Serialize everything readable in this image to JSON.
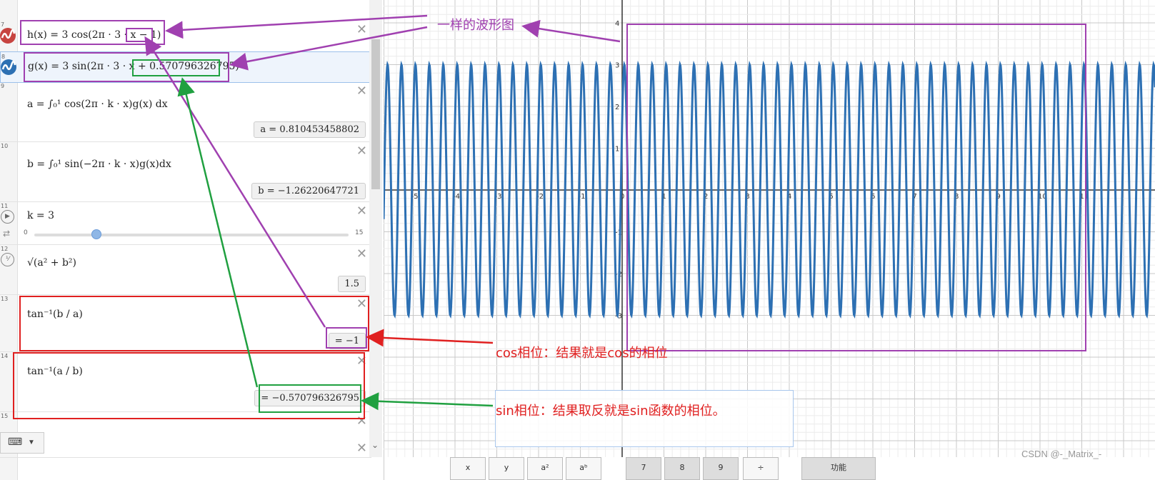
{
  "rows": [
    {
      "num": "7",
      "expr": "h(x) = 3 cos(2π · 3 · x − 1)"
    },
    {
      "num": "8",
      "expr": "g(x) = 3 sin(2π · 3 · x + 0.570796326795)"
    },
    {
      "num": "9",
      "expr": "a = ∫₀¹ cos(2π · k · x)g(x) dx",
      "result": "a = 0.810453458802"
    },
    {
      "num": "10",
      "expr": "b = ∫₀¹ sin(−2π · k · x)g(x)dx",
      "result": "b = −1.26220647721"
    },
    {
      "num": "11",
      "expr": "k = 3",
      "slider_min": "0",
      "slider_max": "15",
      "slider_value": 3
    },
    {
      "num": "12",
      "expr": "√(a² + b²)",
      "result": "1.5"
    },
    {
      "num": "13",
      "expr": "tan⁻¹(b / a)",
      "result": "= −1"
    },
    {
      "num": "14",
      "expr": "tan⁻¹(a / b)",
      "result": "= −0.570796326795"
    },
    {
      "num": "15"
    }
  ],
  "annotations": {
    "same_wave": "一样的波形图",
    "cos_phase": "cos相位：结果就是cos的相位",
    "sin_phase": "sin相位：结果取反就是sin函数的相位。"
  },
  "graph": {
    "x_ticks": [
      "-5",
      "-4",
      "-3",
      "-2",
      "-1",
      "0",
      "1",
      "2",
      "3",
      "4",
      "5",
      "6",
      "7",
      "8",
      "9",
      "10",
      "11"
    ],
    "y_ticks": [
      "4",
      "3",
      "2",
      "1",
      "-1",
      "-2",
      "-3"
    ],
    "curve_color": "#2d70b3",
    "amplitude": 3,
    "frequency": 3
  },
  "keyboard": {
    "keys": [
      "x",
      "y",
      "a²",
      "aᵇ",
      "7",
      "8",
      "9",
      "÷",
      "功能"
    ]
  },
  "watermark": "CSDN @-_Matrix_-",
  "colors": {
    "purple": "#a040b0",
    "green": "#20a040",
    "red": "#e02020",
    "fn_h": "#c74440",
    "fn_g": "#2d70b3"
  }
}
